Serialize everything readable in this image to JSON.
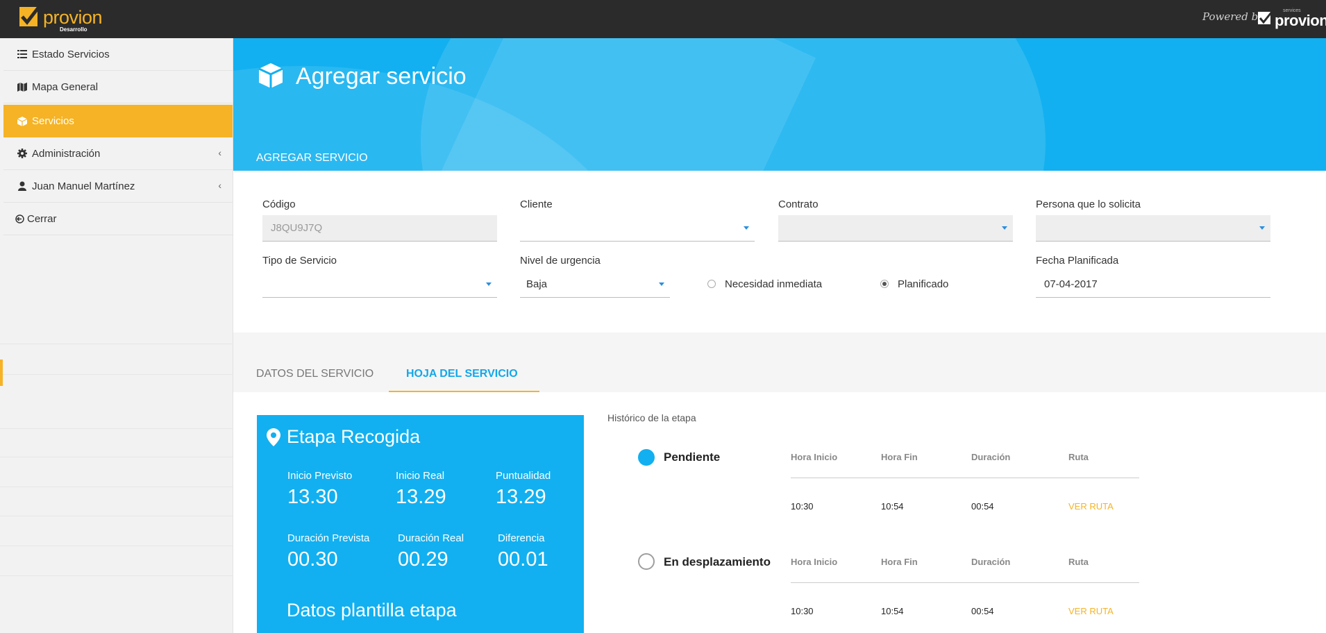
{
  "brand": {
    "name": "provion",
    "env": "Desarrollo",
    "powered_by": "Powered by",
    "powered_services": "services",
    "powered_name": "provion",
    "accent_color": "#f5b325",
    "primary_color": "#12b0f0"
  },
  "sidebar": {
    "items": [
      {
        "label": "Estado Servicios",
        "icon": "list-icon"
      },
      {
        "label": "Mapa General",
        "icon": "map-icon"
      },
      {
        "label": "Servicios",
        "icon": "cube-icon",
        "active": true
      },
      {
        "label": "Administración",
        "icon": "gear-icon"
      },
      {
        "label": "Juan Manuel Martínez",
        "icon": "user-icon"
      },
      {
        "label": "Cerrar",
        "icon": "logout-icon"
      }
    ]
  },
  "header": {
    "title": "Agregar servicio",
    "subtitle": "AGREGAR SERVICIO"
  },
  "form": {
    "codigo": {
      "label": "Código",
      "value": "J8QU9J7Q"
    },
    "cliente": {
      "label": "Cliente",
      "value": ""
    },
    "contrato": {
      "label": "Contrato",
      "value": ""
    },
    "persona": {
      "label": "Persona que lo solicita",
      "value": ""
    },
    "tipo": {
      "label": "Tipo de Servicio",
      "value": ""
    },
    "urgencia": {
      "label": "Nivel de urgencia",
      "value": "Baja"
    },
    "radio_inmediata": {
      "label": "Necesidad inmediata",
      "checked": false
    },
    "radio_planificado": {
      "label": "Planificado",
      "checked": true
    },
    "fecha": {
      "label": "Fecha Planificada",
      "value": "07-04-2017"
    }
  },
  "tabs": [
    {
      "label": "DATOS DEL SERVICIO",
      "active": false
    },
    {
      "label": "HOJA DEL SERVICIO",
      "active": true
    }
  ],
  "stage_card": {
    "title": "Etapa Recogida",
    "metrics": [
      {
        "label": "Inicio Previsto",
        "value": "13.30"
      },
      {
        "label": "Inicio Real",
        "value": "13.29"
      },
      {
        "label": "Puntualidad",
        "value": "13.29"
      },
      {
        "label": "Duración Prevista",
        "value": "00.30"
      },
      {
        "label": "Duración Real",
        "value": "00.29"
      },
      {
        "label": "Diferencia",
        "value": "00.01"
      }
    ],
    "footer": "Datos plantilla etapa"
  },
  "history": {
    "title": "Histórico de la etapa",
    "columns": [
      "Hora Inicio",
      "Hora Fin",
      "Duración",
      "Ruta"
    ],
    "states": [
      {
        "name": "Pendiente",
        "filled": true,
        "hora_inicio": "10:30",
        "hora_fin": "10:54",
        "duracion": "00:54",
        "ruta": "VER RUTA"
      },
      {
        "name": "En desplazamiento",
        "filled": false,
        "hora_inicio": "10:30",
        "hora_fin": "10:54",
        "duracion": "00:54",
        "ruta": "VER RUTA"
      }
    ]
  }
}
